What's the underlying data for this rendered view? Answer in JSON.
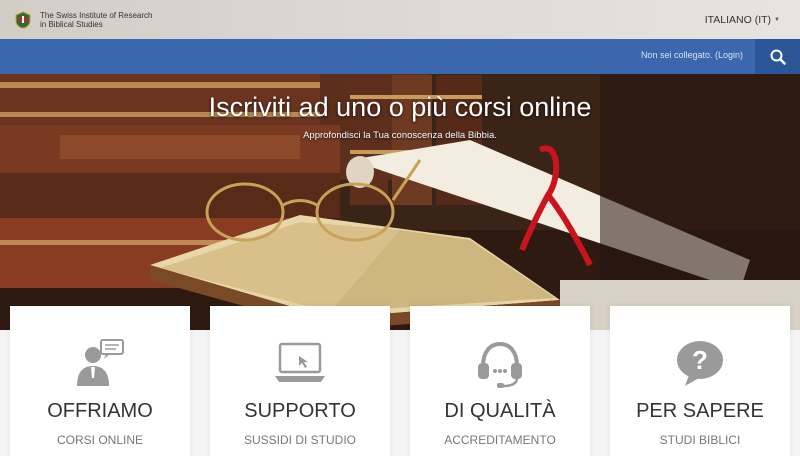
{
  "header": {
    "institute_line1": "The Swiss Institute of Research",
    "institute_line2": "in Biblical Studies",
    "language": "ITALIANO (IT)"
  },
  "nav": {
    "login_text": "Non sei collegato. (Login)",
    "search_icon": "search-icon"
  },
  "hero": {
    "title": "Iscriviti ad uno o più corsi online",
    "subtitle": "Approfondisci la Tua conoscenza della Bibbia."
  },
  "cards": [
    {
      "icon": "presenter-icon",
      "title": "OFFRIAMO",
      "subtitle": "CORSI ONLINE"
    },
    {
      "icon": "laptop-icon",
      "title": "SUPPORTO",
      "subtitle": "SUSSIDI DI STUDIO"
    },
    {
      "icon": "headset-icon",
      "title": "DI QUALITÀ",
      "subtitle": "ACCREDITAMENTO"
    },
    {
      "icon": "question-bubble-icon",
      "title": "PER SAPERE",
      "subtitle": "STUDI BIBLICI"
    }
  ],
  "colors": {
    "nav_blue": "#3a67ad",
    "search_blue": "#2a5597",
    "icon_grey": "#9a9a9a"
  }
}
